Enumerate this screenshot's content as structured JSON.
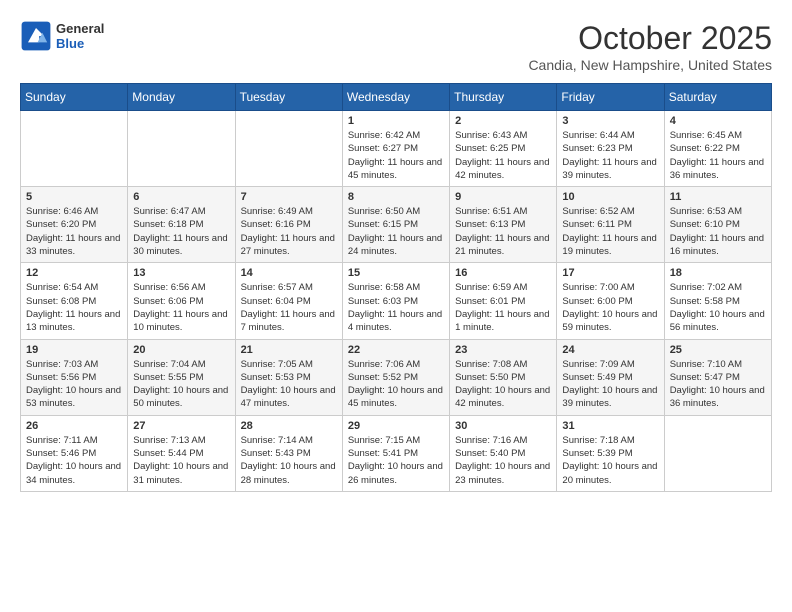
{
  "logo": {
    "general": "General",
    "blue": "Blue"
  },
  "header": {
    "month": "October 2025",
    "location": "Candia, New Hampshire, United States"
  },
  "weekdays": [
    "Sunday",
    "Monday",
    "Tuesday",
    "Wednesday",
    "Thursday",
    "Friday",
    "Saturday"
  ],
  "weeks": [
    [
      {
        "day": "",
        "empty": true
      },
      {
        "day": "",
        "empty": true
      },
      {
        "day": "",
        "empty": true
      },
      {
        "day": "1",
        "sunrise": "6:42 AM",
        "sunset": "6:27 PM",
        "daylight": "11 hours and 45 minutes."
      },
      {
        "day": "2",
        "sunrise": "6:43 AM",
        "sunset": "6:25 PM",
        "daylight": "11 hours and 42 minutes."
      },
      {
        "day": "3",
        "sunrise": "6:44 AM",
        "sunset": "6:23 PM",
        "daylight": "11 hours and 39 minutes."
      },
      {
        "day": "4",
        "sunrise": "6:45 AM",
        "sunset": "6:22 PM",
        "daylight": "11 hours and 36 minutes."
      }
    ],
    [
      {
        "day": "5",
        "sunrise": "6:46 AM",
        "sunset": "6:20 PM",
        "daylight": "11 hours and 33 minutes."
      },
      {
        "day": "6",
        "sunrise": "6:47 AM",
        "sunset": "6:18 PM",
        "daylight": "11 hours and 30 minutes."
      },
      {
        "day": "7",
        "sunrise": "6:49 AM",
        "sunset": "6:16 PM",
        "daylight": "11 hours and 27 minutes."
      },
      {
        "day": "8",
        "sunrise": "6:50 AM",
        "sunset": "6:15 PM",
        "daylight": "11 hours and 24 minutes."
      },
      {
        "day": "9",
        "sunrise": "6:51 AM",
        "sunset": "6:13 PM",
        "daylight": "11 hours and 21 minutes."
      },
      {
        "day": "10",
        "sunrise": "6:52 AM",
        "sunset": "6:11 PM",
        "daylight": "11 hours and 19 minutes."
      },
      {
        "day": "11",
        "sunrise": "6:53 AM",
        "sunset": "6:10 PM",
        "daylight": "11 hours and 16 minutes."
      }
    ],
    [
      {
        "day": "12",
        "sunrise": "6:54 AM",
        "sunset": "6:08 PM",
        "daylight": "11 hours and 13 minutes."
      },
      {
        "day": "13",
        "sunrise": "6:56 AM",
        "sunset": "6:06 PM",
        "daylight": "11 hours and 10 minutes."
      },
      {
        "day": "14",
        "sunrise": "6:57 AM",
        "sunset": "6:04 PM",
        "daylight": "11 hours and 7 minutes."
      },
      {
        "day": "15",
        "sunrise": "6:58 AM",
        "sunset": "6:03 PM",
        "daylight": "11 hours and 4 minutes."
      },
      {
        "day": "16",
        "sunrise": "6:59 AM",
        "sunset": "6:01 PM",
        "daylight": "11 hours and 1 minute."
      },
      {
        "day": "17",
        "sunrise": "7:00 AM",
        "sunset": "6:00 PM",
        "daylight": "10 hours and 59 minutes."
      },
      {
        "day": "18",
        "sunrise": "7:02 AM",
        "sunset": "5:58 PM",
        "daylight": "10 hours and 56 minutes."
      }
    ],
    [
      {
        "day": "19",
        "sunrise": "7:03 AM",
        "sunset": "5:56 PM",
        "daylight": "10 hours and 53 minutes."
      },
      {
        "day": "20",
        "sunrise": "7:04 AM",
        "sunset": "5:55 PM",
        "daylight": "10 hours and 50 minutes."
      },
      {
        "day": "21",
        "sunrise": "7:05 AM",
        "sunset": "5:53 PM",
        "daylight": "10 hours and 47 minutes."
      },
      {
        "day": "22",
        "sunrise": "7:06 AM",
        "sunset": "5:52 PM",
        "daylight": "10 hours and 45 minutes."
      },
      {
        "day": "23",
        "sunrise": "7:08 AM",
        "sunset": "5:50 PM",
        "daylight": "10 hours and 42 minutes."
      },
      {
        "day": "24",
        "sunrise": "7:09 AM",
        "sunset": "5:49 PM",
        "daylight": "10 hours and 39 minutes."
      },
      {
        "day": "25",
        "sunrise": "7:10 AM",
        "sunset": "5:47 PM",
        "daylight": "10 hours and 36 minutes."
      }
    ],
    [
      {
        "day": "26",
        "sunrise": "7:11 AM",
        "sunset": "5:46 PM",
        "daylight": "10 hours and 34 minutes."
      },
      {
        "day": "27",
        "sunrise": "7:13 AM",
        "sunset": "5:44 PM",
        "daylight": "10 hours and 31 minutes."
      },
      {
        "day": "28",
        "sunrise": "7:14 AM",
        "sunset": "5:43 PM",
        "daylight": "10 hours and 28 minutes."
      },
      {
        "day": "29",
        "sunrise": "7:15 AM",
        "sunset": "5:41 PM",
        "daylight": "10 hours and 26 minutes."
      },
      {
        "day": "30",
        "sunrise": "7:16 AM",
        "sunset": "5:40 PM",
        "daylight": "10 hours and 23 minutes."
      },
      {
        "day": "31",
        "sunrise": "7:18 AM",
        "sunset": "5:39 PM",
        "daylight": "10 hours and 20 minutes."
      },
      {
        "day": "",
        "empty": true
      }
    ]
  ]
}
